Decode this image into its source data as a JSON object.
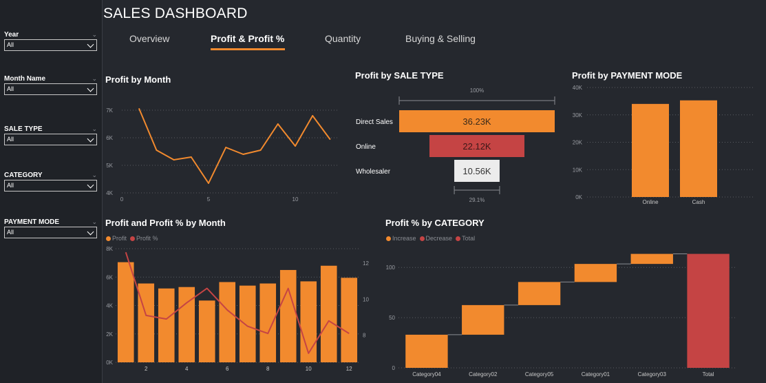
{
  "page": {
    "title": "SALES DASHBOARD"
  },
  "colors": {
    "orange": "#f28a2e",
    "red": "#c54444",
    "grid": "#5a5d63",
    "axis_text": "#9a9da3"
  },
  "tabs": [
    {
      "label": "Overview"
    },
    {
      "label": "Profit & Profit %"
    },
    {
      "label": "Quantity"
    },
    {
      "label": "Buying & Selling"
    }
  ],
  "active_tab": 1,
  "filters": [
    {
      "label": "Year",
      "value": "All"
    },
    {
      "label": "Month Name",
      "value": "All"
    },
    {
      "label": "SALE TYPE",
      "value": "All"
    },
    {
      "label": "CATEGORY",
      "value": "All"
    },
    {
      "label": "PAYMENT MODE",
      "value": "All"
    }
  ],
  "chart_data": [
    {
      "id": "profit_by_month",
      "type": "line",
      "title": "Profit by Month",
      "x": [
        1,
        2,
        3,
        4,
        5,
        6,
        7,
        8,
        9,
        10,
        11,
        12
      ],
      "values": [
        7050,
        5550,
        5200,
        5300,
        4350,
        5650,
        5400,
        5550,
        6500,
        5700,
        6800,
        5950
      ],
      "xticks": [
        0,
        5,
        10
      ],
      "yticks": [
        4000,
        5000,
        6000,
        7000
      ],
      "ytick_labels": [
        "4K",
        "5K",
        "6K",
        "7K"
      ],
      "xlim": [
        0,
        12.5
      ],
      "ylim": [
        4000,
        7300
      ],
      "grid": true
    },
    {
      "id": "profit_by_sale_type",
      "type": "funnel",
      "title": "Profit by SALE TYPE",
      "categories": [
        "Direct Sales",
        "Online",
        "Wholesaler"
      ],
      "values": [
        36230,
        22120,
        10560
      ],
      "value_labels": [
        "36.23K",
        "22.12K",
        "10.56K"
      ],
      "colors": [
        "#f28a2e",
        "#c54444",
        "#ececec"
      ],
      "label_colors": [
        "#3a2a1a",
        "#3a1818",
        "#333333"
      ],
      "top_label": "100%",
      "bottom_label": "29.1%"
    },
    {
      "id": "profit_by_payment_mode",
      "type": "bar",
      "title": "Profit by PAYMENT MODE",
      "categories": [
        "Online",
        "Cash"
      ],
      "values": [
        34000,
        35300
      ],
      "yticks": [
        0,
        10000,
        20000,
        30000,
        40000
      ],
      "ytick_labels": [
        "0K",
        "10K",
        "20K",
        "30K",
        "40K"
      ],
      "ylim": [
        0,
        40000
      ],
      "grid": true
    },
    {
      "id": "profit_and_profit_pct_by_month",
      "type": "bar",
      "title": "Profit and Profit % by Month",
      "x": [
        1,
        2,
        3,
        4,
        5,
        6,
        7,
        8,
        9,
        10,
        11,
        12
      ],
      "xticks": [
        2,
        4,
        6,
        8,
        10,
        12
      ],
      "legend": [
        "Profit",
        "Profit %"
      ],
      "series": [
        {
          "name": "Profit",
          "type": "bar",
          "values": [
            7050,
            5550,
            5200,
            5300,
            4350,
            5650,
            5400,
            5550,
            6500,
            5700,
            6800,
            5950
          ]
        },
        {
          "name": "Profit %",
          "type": "line",
          "axis": "right",
          "values": [
            12.6,
            9.1,
            8.9,
            9.8,
            10.6,
            9.4,
            8.5,
            8.1,
            10.6,
            7.0,
            8.8,
            8.1
          ]
        }
      ],
      "yticks_left": [
        0,
        2000,
        4000,
        6000,
        8000
      ],
      "ytick_labels_left": [
        "0K",
        "2K",
        "4K",
        "6K",
        "8K"
      ],
      "ylim_left": [
        0,
        8000
      ],
      "yticks_right": [
        8,
        10,
        12
      ],
      "ylim_right": [
        6.5,
        12.8
      ],
      "grid": true
    },
    {
      "id": "profit_pct_by_category",
      "type": "waterfall",
      "title": "Profit % by CATEGORY",
      "legend": [
        "Increase",
        "Decrease",
        "Total"
      ],
      "categories": [
        "Category04",
        "Category02",
        "Category05",
        "Category01",
        "Category03",
        "Total"
      ],
      "values": [
        33,
        29.5,
        23,
        18,
        10,
        113.5
      ],
      "is_total": [
        false,
        false,
        false,
        false,
        false,
        true
      ],
      "yticks": [
        0,
        50,
        100
      ],
      "ylim": [
        0,
        118
      ],
      "grid": true
    }
  ]
}
